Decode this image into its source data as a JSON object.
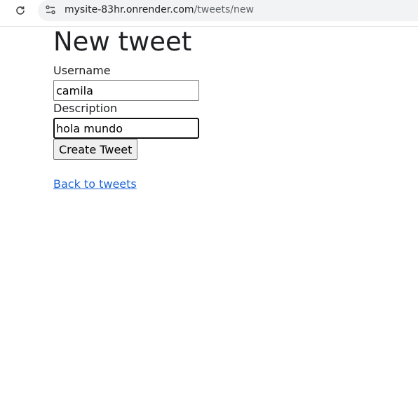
{
  "browser": {
    "url_host": "mysite-83hr.onrender.com",
    "url_path": "/tweets/new",
    "reload_icon": "reload-icon",
    "site_info_icon": "site-info-icon"
  },
  "page": {
    "title": "New tweet",
    "form": {
      "username_label": "Username",
      "username_value": "camila",
      "description_label": "Description",
      "description_value": "hola mundo",
      "submit_label": "Create Tweet"
    },
    "back_link": "Back to tweets"
  },
  "colors": {
    "link": "#1a65d6",
    "text": "#202124",
    "omnibox_bg": "#f1f3f4"
  }
}
